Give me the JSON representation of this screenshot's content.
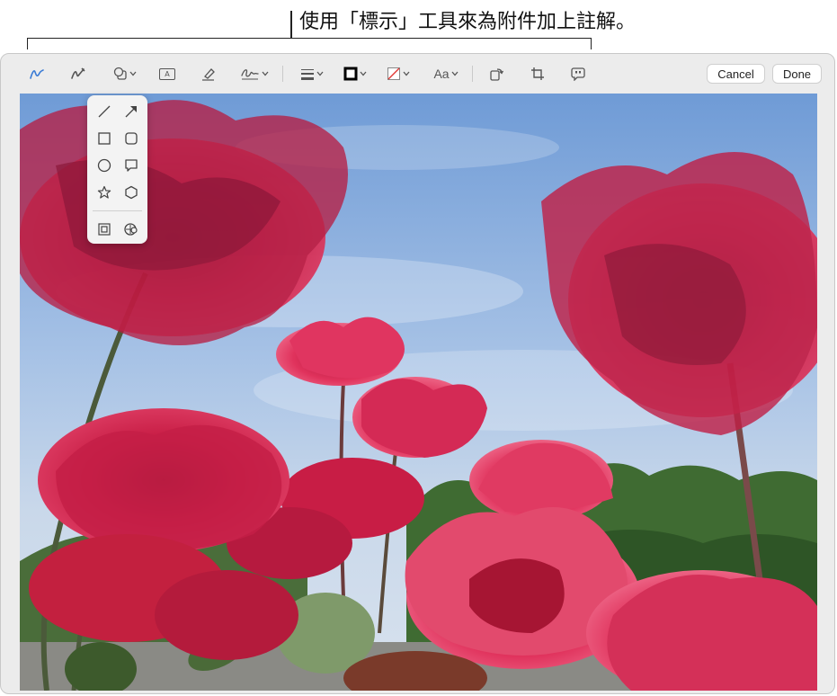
{
  "callout": {
    "text": "使用「標示」工具來為附件加上註解。"
  },
  "toolbar": {
    "cancel_label": "Cancel",
    "done_label": "Done",
    "text_style_label": "Aa",
    "text_box_glyph": "A"
  },
  "colors": {
    "accent": "#3a7bd5",
    "window_bg": "#ececec",
    "sky": "#8fb3e0",
    "rose": "#d0204a"
  },
  "shapes_popover": {
    "items": [
      "line",
      "arrow",
      "square",
      "rounded-rectangle",
      "circle",
      "speech-bubble",
      "star",
      "hexagon",
      "loupe",
      "highlight"
    ]
  }
}
